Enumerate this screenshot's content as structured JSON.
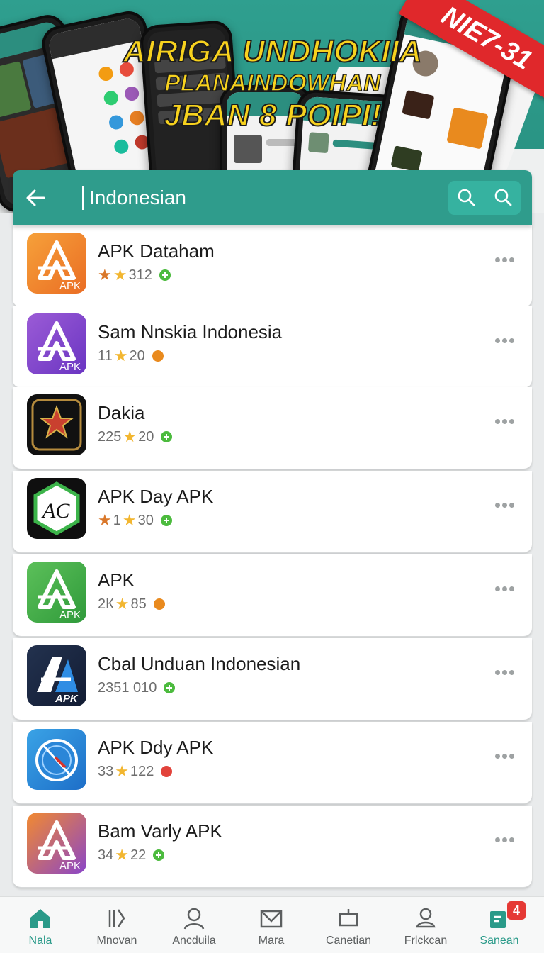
{
  "banner": {
    "line1": "AIRIGA UNDHOKIIA",
    "line2": "PLANAINDOWHAN",
    "line3": "JBAN 8 POIPI!",
    "corner_tag": "NIE7-31"
  },
  "search": {
    "query": "Indonesian",
    "back_icon": "arrow-left-icon",
    "icons": [
      "search-icon",
      "search-icon"
    ]
  },
  "apps": [
    {
      "name": "APK Dataham",
      "rating": "312",
      "stars": "★★",
      "badge": "green",
      "icon": "apk-orange"
    },
    {
      "name": "Sam Nnskia Indonesia",
      "rating_prefix": "11",
      "stars": "★",
      "rating": "20",
      "badge": "orange",
      "icon": "apk-purple"
    },
    {
      "name": "Dakia",
      "rating_prefix": "225",
      "stars": "★",
      "rating": "20",
      "badge": "green",
      "icon": "dark-emblem"
    },
    {
      "name": "APK Day APK",
      "rating_prefix": "1",
      "stars": "★★",
      "rating": "30",
      "badge": "green",
      "icon": "ac-hexagon"
    },
    {
      "name": "APK",
      "rating_prefix": "2К",
      "stars": "★",
      "rating": "85",
      "badge": "orange",
      "icon": "apk-green"
    },
    {
      "name": "Cbal Unduan Indonesian",
      "rating_prefix": "2351 010",
      "stars": "",
      "rating": "",
      "badge": "green",
      "icon": "apk-navy"
    },
    {
      "name": "APK Ddy APK",
      "rating_prefix": "33",
      "stars": "★",
      "rating": "122",
      "badge": "red",
      "icon": "compass-blue"
    },
    {
      "name": "Bam Varly APK",
      "rating_prefix": "34",
      "stars": "★",
      "rating": "22",
      "badge": "green",
      "icon": "apk-gradient"
    }
  ],
  "nav": [
    {
      "label": "Nala",
      "icon": "home-icon",
      "active": true
    },
    {
      "label": "Mnovan",
      "icon": "library-icon"
    },
    {
      "label": "Ancduila",
      "icon": "user-icon"
    },
    {
      "label": "Mara",
      "icon": "mail-icon"
    },
    {
      "label": "Canetian",
      "icon": "tag-icon"
    },
    {
      "label": "Frlckcan",
      "icon": "profile-icon"
    },
    {
      "label": "Sanean",
      "icon": "updates-icon",
      "badge": "4"
    }
  ],
  "colors": {
    "accent": "#2f9c8c",
    "star": "#f2b630",
    "star_dark": "#d9772a"
  }
}
